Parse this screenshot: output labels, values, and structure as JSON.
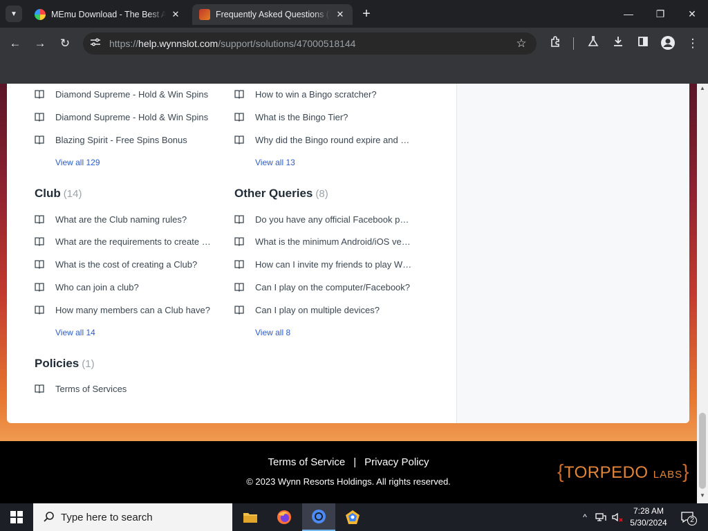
{
  "browser": {
    "tabs": [
      {
        "title": "MEmu Download - The Best Android Emulator",
        "active": false
      },
      {
        "title": "Frequently Asked Questions (FAQ)",
        "active": true
      }
    ],
    "url_scheme": "https://",
    "url_host": "help.wynnslot.com",
    "url_path": "/support/solutions/47000518144"
  },
  "sections": [
    {
      "name": "",
      "count": "",
      "articles": [
        "Diamond Supreme - Hold & Win Spins",
        "Diamond Supreme - Hold & Win Spins",
        "Blazing Spirit - Free Spins Bonus"
      ],
      "view_all": "View all 129"
    },
    {
      "name": "",
      "count": "",
      "articles": [
        "How to win a Bingo scratcher?",
        "What is the Bingo Tier?",
        "Why did the Bingo round expire and …"
      ],
      "view_all": "View all 13"
    },
    {
      "name": "Club",
      "count": "(14)",
      "articles": [
        "What are the Club naming rules?",
        "What are the requirements to create …",
        "What is the cost of creating a Club?",
        "Who can join a club?",
        "How many members can a Club have?"
      ],
      "view_all": "View all 14"
    },
    {
      "name": "Other Queries",
      "count": "(8)",
      "articles": [
        "Do you have any official Facebook pa…",
        "What is the minimum Android/iOS ve…",
        "How can I invite my friends to play W…",
        "Can I play on the computer/Facebook?",
        "Can I play on multiple devices?"
      ],
      "view_all": "View all 8"
    },
    {
      "name": "Policies",
      "count": "(1)",
      "articles": [
        "Terms of Services"
      ],
      "view_all": ""
    }
  ],
  "footer": {
    "terms": "Terms of Service",
    "separator": "|",
    "privacy": "Privacy Policy",
    "copyright": "© 2023 Wynn Resorts Holdings. All rights reserved.",
    "logo_main": "TORPEDO",
    "logo_sub": "LABS"
  },
  "taskbar": {
    "search_placeholder": "Type here to search",
    "time": "7:28 AM",
    "date": "5/30/2024",
    "notifications": "2"
  },
  "colors": {
    "link": "#2c5cc5",
    "heading": "#1f2b36",
    "logo": "#e0853a"
  }
}
